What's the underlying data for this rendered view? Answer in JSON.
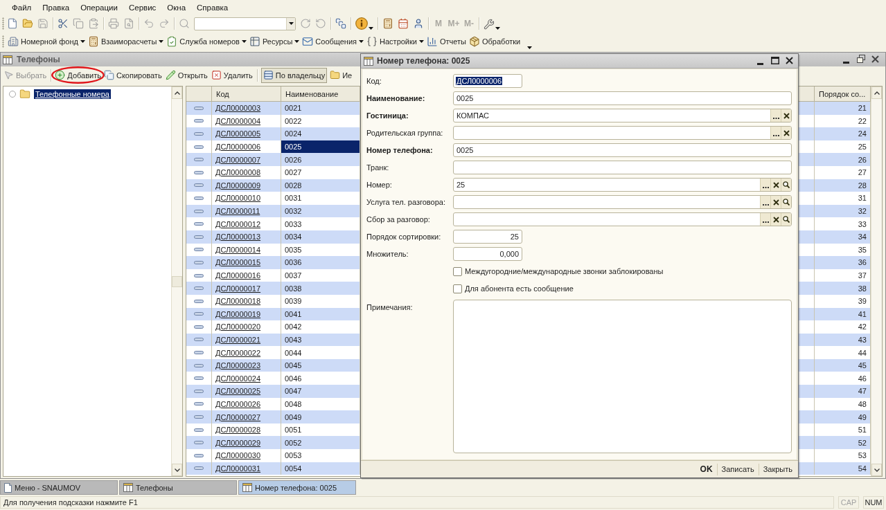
{
  "menu_bar": [
    "Файл",
    "Правка",
    "Операции",
    "Сервис",
    "Окна",
    "Справка"
  ],
  "standard_toolbar": {
    "memory_buttons": [
      {
        "label": "M",
        "disabled": true
      },
      {
        "label": "M+",
        "disabled": true
      },
      {
        "label": "M-",
        "disabled": true
      }
    ]
  },
  "sections_toolbar": [
    {
      "label": "Номерной фонд",
      "dropdown": true
    },
    {
      "label": "Взаиморасчеты",
      "dropdown": true
    },
    {
      "label": "Служба номеров",
      "dropdown": true
    },
    {
      "label": "Ресурсы",
      "dropdown": true
    },
    {
      "label": "Сообщения",
      "dropdown": true
    },
    {
      "label": "Настройки",
      "dropdown": true
    },
    {
      "label": "Отчеты",
      "dropdown": false
    },
    {
      "label": "Обработки",
      "dropdown": false
    }
  ],
  "list_window": {
    "title": "Телефоны",
    "toolbar": [
      {
        "label": "Выбрать",
        "disabled": true,
        "pressed": false,
        "circled": false
      },
      {
        "label": "Добавить",
        "disabled": false,
        "pressed": false,
        "circled": true
      },
      {
        "label": "Скопировать",
        "disabled": false,
        "pressed": false,
        "circled": false
      },
      {
        "label": "Открыть",
        "disabled": false,
        "pressed": false,
        "circled": false
      },
      {
        "label": "Удалить",
        "disabled": false,
        "pressed": false,
        "circled": false
      },
      {
        "label": "По владельцу",
        "disabled": false,
        "pressed": true,
        "circled": false
      },
      {
        "label": "Ие",
        "disabled": false,
        "pressed": false,
        "circled": false
      }
    ],
    "tree": [
      {
        "label": "Телефонные номера",
        "selected": true
      }
    ],
    "table": {
      "columns": [
        "Код",
        "Наименование",
        "Порядок со..."
      ],
      "rows": [
        {
          "code": "ДСЛ0000003",
          "name": "0021",
          "order": "21",
          "selected": false
        },
        {
          "code": "ДСЛ0000004",
          "name": "0022",
          "order": "22",
          "selected": false
        },
        {
          "code": "ДСЛ0000005",
          "name": "0024",
          "order": "24",
          "selected": false
        },
        {
          "code": "ДСЛ0000006",
          "name": "0025",
          "order": "25",
          "selected": true
        },
        {
          "code": "ДСЛ0000007",
          "name": "0026",
          "order": "26",
          "selected": false
        },
        {
          "code": "ДСЛ0000008",
          "name": "0027",
          "order": "27",
          "selected": false
        },
        {
          "code": "ДСЛ0000009",
          "name": "0028",
          "order": "28",
          "selected": false
        },
        {
          "code": "ДСЛ0000010",
          "name": "0031",
          "order": "31",
          "selected": false
        },
        {
          "code": "ДСЛ0000011",
          "name": "0032",
          "order": "32",
          "selected": false
        },
        {
          "code": "ДСЛ0000012",
          "name": "0033",
          "order": "33",
          "selected": false
        },
        {
          "code": "ДСЛ0000013",
          "name": "0034",
          "order": "34",
          "selected": false
        },
        {
          "code": "ДСЛ0000014",
          "name": "0035",
          "order": "35",
          "selected": false
        },
        {
          "code": "ДСЛ0000015",
          "name": "0036",
          "order": "36",
          "selected": false
        },
        {
          "code": "ДСЛ0000016",
          "name": "0037",
          "order": "37",
          "selected": false
        },
        {
          "code": "ДСЛ0000017",
          "name": "0038",
          "order": "38",
          "selected": false
        },
        {
          "code": "ДСЛ0000018",
          "name": "0039",
          "order": "39",
          "selected": false
        },
        {
          "code": "ДСЛ0000019",
          "name": "0041",
          "order": "41",
          "selected": false
        },
        {
          "code": "ДСЛ0000020",
          "name": "0042",
          "order": "42",
          "selected": false
        },
        {
          "code": "ДСЛ0000021",
          "name": "0043",
          "order": "43",
          "selected": false
        },
        {
          "code": "ДСЛ0000022",
          "name": "0044",
          "order": "44",
          "selected": false
        },
        {
          "code": "ДСЛ0000023",
          "name": "0045",
          "order": "45",
          "selected": false
        },
        {
          "code": "ДСЛ0000024",
          "name": "0046",
          "order": "46",
          "selected": false
        },
        {
          "code": "ДСЛ0000025",
          "name": "0047",
          "order": "47",
          "selected": false
        },
        {
          "code": "ДСЛ0000026",
          "name": "0048",
          "order": "48",
          "selected": false
        },
        {
          "code": "ДСЛ0000027",
          "name": "0049",
          "order": "49",
          "selected": false
        },
        {
          "code": "ДСЛ0000028",
          "name": "0051",
          "order": "51",
          "selected": false
        },
        {
          "code": "ДСЛ0000029",
          "name": "0052",
          "order": "52",
          "selected": false
        },
        {
          "code": "ДСЛ0000030",
          "name": "0053",
          "order": "53",
          "selected": false
        },
        {
          "code": "ДСЛ0000031",
          "name": "0054",
          "order": "54",
          "selected": false
        }
      ]
    }
  },
  "dialog": {
    "title": "Номер телефона: 0025",
    "fields": [
      {
        "label": "Код:",
        "kind": "code",
        "required": false,
        "value": "ДСЛ0000006",
        "text_selected": true
      },
      {
        "label": "Наименование:",
        "kind": "text",
        "required": true,
        "value": "0025",
        "text_selected": false
      },
      {
        "label": "Гостиница:",
        "kind": "reference",
        "required": true,
        "value": "КОМПАС",
        "text_selected": false
      },
      {
        "label": "Родительская группа:",
        "kind": "reference",
        "required": false
      },
      {
        "label": "Номер телефона:",
        "kind": "text",
        "required": true,
        "value": "0025",
        "text_selected": false
      },
      {
        "label": "Транк:",
        "kind": "text",
        "required": false
      },
      {
        "label": "Номер:",
        "kind": "lookup",
        "required": false,
        "value": "25",
        "text_selected": false
      },
      {
        "label": "Услуга тел. разговора:",
        "kind": "lookup",
        "required": false
      },
      {
        "label": "Сбор за разговор:",
        "kind": "lookup",
        "required": false
      },
      {
        "label": "Порядок сортировки:",
        "kind": "number",
        "required": false,
        "value": "25",
        "text_selected": false
      },
      {
        "label": "Множитель:",
        "kind": "number",
        "required": false,
        "value": "0,000",
        "text_selected": false
      }
    ],
    "checkboxes": [
      {
        "label": "Междугородние/международные звонки заблокированы",
        "checked": false
      },
      {
        "label": "Для абонента есть сообщение",
        "checked": false
      }
    ],
    "notes": {
      "label": "Примечания:"
    },
    "buttons": [
      {
        "label": "OK",
        "default": true
      },
      {
        "label": "Записать",
        "default": false
      },
      {
        "label": "Закрыть",
        "default": false
      }
    ]
  },
  "taskbar": [
    {
      "label": "Меню - SNAUMOV",
      "kind": "menu",
      "selected": false
    },
    {
      "label": "Телефоны",
      "kind": "list",
      "selected": false
    },
    {
      "label": "Номер телефона: 0025",
      "kind": "form",
      "selected": true
    }
  ],
  "status_bar": {
    "hint": "Для получения подсказки нажмите F1",
    "indicators": [
      {
        "label": "CAP",
        "on": false
      },
      {
        "label": "NUM",
        "on": true
      }
    ]
  }
}
